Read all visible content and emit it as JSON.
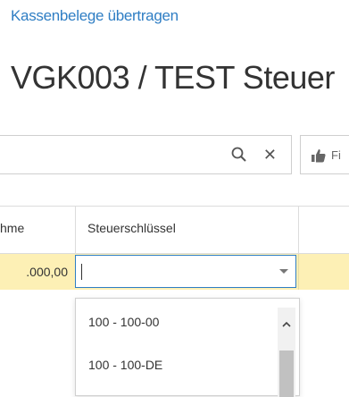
{
  "breadcrumb": "Kassenbelege übertragen",
  "page_title": "VGK003 / TEST Steuer",
  "search": {
    "placeholder": "",
    "value": ""
  },
  "filter_button": {
    "label": "Fi"
  },
  "grid": {
    "headers": [
      "hme",
      "Steuerschlüssel"
    ],
    "row": {
      "amount": ".000,00",
      "tax_key_value": ""
    }
  },
  "dropdown": {
    "options": [
      "100 - 100-00",
      "100 - 100-DE"
    ]
  },
  "colors": {
    "accent": "#2f7ec4",
    "row_highlight": "#fdf0b5",
    "border": "#cfcfcf"
  },
  "icons": [
    "search-icon",
    "close-icon",
    "thumbs-up-icon",
    "chevron-down-icon",
    "chevron-up-icon"
  ]
}
